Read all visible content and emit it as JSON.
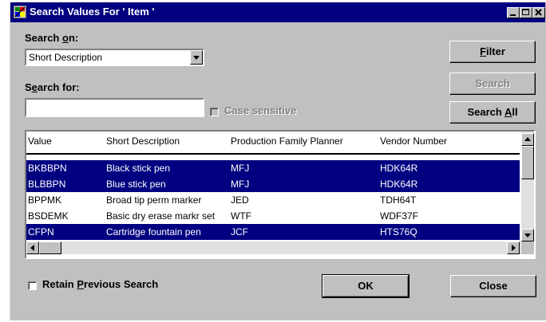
{
  "window": {
    "title": "Search Values For ' Item '"
  },
  "search_on": {
    "label_pre": "Search ",
    "label_access": "o",
    "label_post": "n:",
    "value": "Short Description"
  },
  "search_for": {
    "label_pre": "S",
    "label_access": "e",
    "label_post": "arch for:",
    "value": ""
  },
  "case_sensitive": {
    "label": "Case sensitive",
    "checked": false,
    "enabled": false
  },
  "buttons": {
    "filter_access": "F",
    "filter_post": "ilter",
    "search": "Search",
    "search_all_pre": "Search ",
    "search_all_access": "A",
    "search_all_post": "ll",
    "ok": "OK",
    "close": "Close"
  },
  "retain": {
    "label_pre": "Retain ",
    "label_access": "P",
    "label_post": "revious Search",
    "checked": false
  },
  "grid": {
    "columns": [
      "Value",
      "Short Description",
      "Production Family Planner",
      "Vendor Number"
    ],
    "rows": [
      {
        "selected": true,
        "cells": [
          "BKBBPN",
          "Black stick pen",
          "MFJ",
          "HDK64R"
        ]
      },
      {
        "selected": true,
        "cells": [
          "BLBBPN",
          "Blue stick pen",
          "MFJ",
          "HDK64R"
        ]
      },
      {
        "selected": false,
        "cells": [
          "BPPMK",
          "Broad tip perm marker",
          "JED",
          "TDH64T"
        ]
      },
      {
        "selected": false,
        "cells": [
          "BSDEMK",
          "Basic dry erase markr set",
          "WTF",
          "WDF37F"
        ]
      },
      {
        "selected": true,
        "cells": [
          "CFPN",
          "Cartridge fountain pen",
          "JCF",
          "HTS76Q"
        ]
      }
    ]
  },
  "colors": {
    "title_bar": "#000080",
    "selection": "#000080",
    "face": "#c0c0c0"
  }
}
